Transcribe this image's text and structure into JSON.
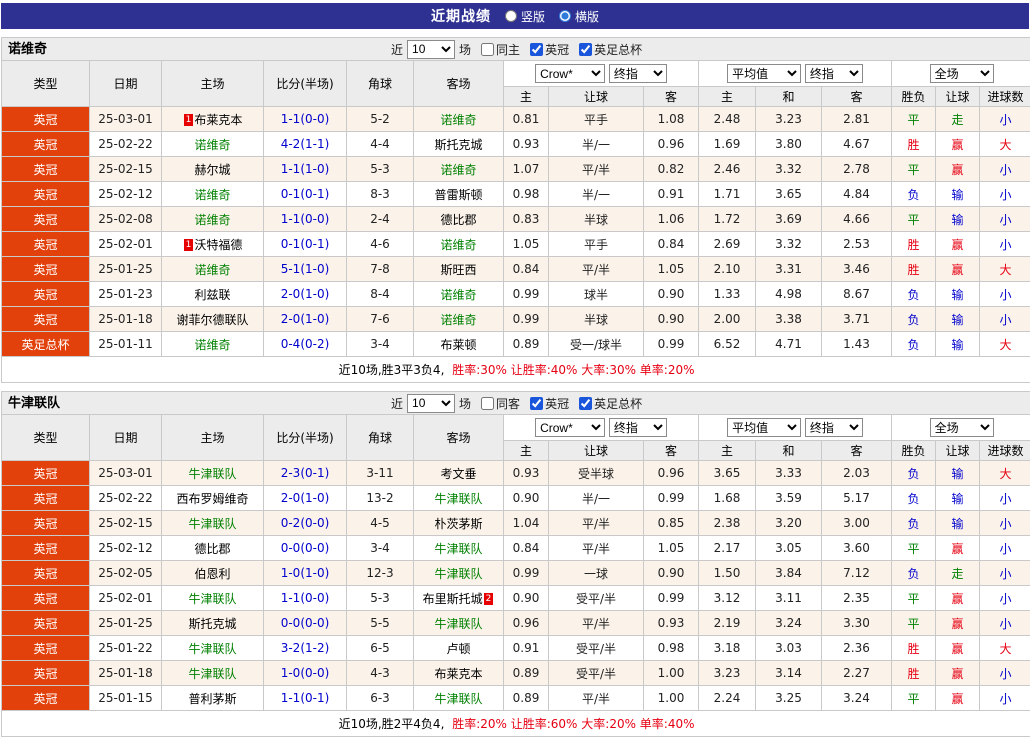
{
  "colors": {
    "topbar_bg": "#2e3192",
    "league_badge_bg": "#e2410c",
    "team_highlight_green": "#008000",
    "score_blue": "#0000cd",
    "result_win_red": "#e60012",
    "result_draw_green": "#008000",
    "result_loss_blue": "#0000cd"
  },
  "topbar": {
    "title": "近期战绩",
    "layout_options": [
      {
        "label": "竖版",
        "checked": false
      },
      {
        "label": "横版",
        "checked": true
      }
    ]
  },
  "header": {
    "main_columns": [
      "类型",
      "日期",
      "主场",
      "比分(半场)",
      "角球",
      "客场"
    ],
    "sub_columns": [
      "主",
      "让球",
      "客",
      "主",
      "和",
      "客",
      "胜负",
      "让球",
      "进球数"
    ],
    "group1_selects": [
      "Crow*",
      "终指"
    ],
    "group2_selects": [
      "平均值",
      "终指"
    ],
    "group3_selects": [
      "全场"
    ]
  },
  "tables": [
    {
      "team": "诺维奇",
      "filter": {
        "prefix": "近",
        "count": "10",
        "suffix": "场",
        "checkboxes": [
          {
            "label": "同主",
            "checked": false
          },
          {
            "label": "英冠",
            "checked": true
          },
          {
            "label": "英足总杯",
            "checked": true
          }
        ]
      },
      "rows": [
        {
          "type": "英冠",
          "date": "25-03-01",
          "home": "布莱克本",
          "home_badge": "1",
          "home_badge_pos": "pre",
          "score": "1-1(0-0)",
          "corner": "5-2",
          "away": "诺维奇",
          "away_green": true,
          "odds": [
            "0.81",
            "平手",
            "1.08"
          ],
          "avg": [
            "2.48",
            "3.23",
            "2.81"
          ],
          "result": [
            "平",
            "走",
            "小"
          ]
        },
        {
          "type": "英冠",
          "date": "25-02-22",
          "home": "诺维奇",
          "home_green": true,
          "score": "4-2(1-1)",
          "corner": "4-4",
          "away": "斯托克城",
          "odds": [
            "0.93",
            "半/一",
            "0.96"
          ],
          "avg": [
            "1.69",
            "3.80",
            "4.67"
          ],
          "result": [
            "胜",
            "赢",
            "大"
          ]
        },
        {
          "type": "英冠",
          "date": "25-02-15",
          "home": "赫尔城",
          "score": "1-1(1-0)",
          "corner": "5-3",
          "away": "诺维奇",
          "away_green": true,
          "odds": [
            "1.07",
            "平/半",
            "0.82"
          ],
          "avg": [
            "2.46",
            "3.32",
            "2.78"
          ],
          "result": [
            "平",
            "赢",
            "小"
          ]
        },
        {
          "type": "英冠",
          "date": "25-02-12",
          "home": "诺维奇",
          "home_green": true,
          "score": "0-1(0-1)",
          "corner": "8-3",
          "away": "普雷斯顿",
          "odds": [
            "0.98",
            "半/一",
            "0.91"
          ],
          "avg": [
            "1.71",
            "3.65",
            "4.84"
          ],
          "result": [
            "负",
            "输",
            "小"
          ]
        },
        {
          "type": "英冠",
          "date": "25-02-08",
          "home": "诺维奇",
          "home_green": true,
          "score": "1-1(0-0)",
          "corner": "2-4",
          "away": "德比郡",
          "odds": [
            "0.83",
            "半球",
            "1.06"
          ],
          "avg": [
            "1.72",
            "3.69",
            "4.66"
          ],
          "result": [
            "平",
            "输",
            "小"
          ]
        },
        {
          "type": "英冠",
          "date": "25-02-01",
          "home": "沃特福德",
          "home_badge": "1",
          "home_badge_pos": "pre",
          "score": "0-1(0-1)",
          "corner": "4-6",
          "away": "诺维奇",
          "away_green": true,
          "odds": [
            "1.05",
            "平手",
            "0.84"
          ],
          "avg": [
            "2.69",
            "3.32",
            "2.53"
          ],
          "result": [
            "胜",
            "赢",
            "小"
          ]
        },
        {
          "type": "英冠",
          "date": "25-01-25",
          "home": "诺维奇",
          "home_green": true,
          "score": "5-1(1-0)",
          "corner": "7-8",
          "away": "斯旺西",
          "odds": [
            "0.84",
            "平/半",
            "1.05"
          ],
          "avg": [
            "2.10",
            "3.31",
            "3.46"
          ],
          "result": [
            "胜",
            "赢",
            "大"
          ]
        },
        {
          "type": "英冠",
          "date": "25-01-23",
          "home": "利兹联",
          "score": "2-0(1-0)",
          "corner": "8-4",
          "away": "诺维奇",
          "away_green": true,
          "odds": [
            "0.99",
            "球半",
            "0.90"
          ],
          "avg": [
            "1.33",
            "4.98",
            "8.67"
          ],
          "result": [
            "负",
            "输",
            "小"
          ]
        },
        {
          "type": "英冠",
          "date": "25-01-18",
          "home": "谢菲尔德联队",
          "score": "2-0(1-0)",
          "corner": "7-6",
          "away": "诺维奇",
          "away_green": true,
          "odds": [
            "0.99",
            "半球",
            "0.90"
          ],
          "avg": [
            "2.00",
            "3.38",
            "3.71"
          ],
          "result": [
            "负",
            "输",
            "小"
          ]
        },
        {
          "type": "英足总杯",
          "date": "25-01-11",
          "home": "诺维奇",
          "home_green": true,
          "score": "0-4(0-2)",
          "corner": "3-4",
          "away": "布莱顿",
          "odds": [
            "0.89",
            "受一/球半",
            "0.99"
          ],
          "avg": [
            "6.52",
            "4.71",
            "1.43"
          ],
          "result": [
            "负",
            "输",
            "大"
          ]
        }
      ],
      "footer_plain": "近10场,胜3平3负4,",
      "footer_red": "胜率:30% 让胜率:40% 大率:30% 单率:20%"
    },
    {
      "team": "牛津联队",
      "filter": {
        "prefix": "近",
        "count": "10",
        "suffix": "场",
        "checkboxes": [
          {
            "label": "同客",
            "checked": false
          },
          {
            "label": "英冠",
            "checked": true
          },
          {
            "label": "英足总杯",
            "checked": true
          }
        ]
      },
      "rows": [
        {
          "type": "英冠",
          "date": "25-03-01",
          "home": "牛津联队",
          "home_green": true,
          "score": "2-3(0-1)",
          "corner": "3-11",
          "away": "考文垂",
          "odds": [
            "0.93",
            "受半球",
            "0.96"
          ],
          "avg": [
            "3.65",
            "3.33",
            "2.03"
          ],
          "result": [
            "负",
            "输",
            "大"
          ]
        },
        {
          "type": "英冠",
          "date": "25-02-22",
          "home": "西布罗姆维奇",
          "score": "2-0(1-0)",
          "corner": "13-2",
          "away": "牛津联队",
          "away_green": true,
          "odds": [
            "0.90",
            "半/一",
            "0.99"
          ],
          "avg": [
            "1.68",
            "3.59",
            "5.17"
          ],
          "result": [
            "负",
            "输",
            "小"
          ]
        },
        {
          "type": "英冠",
          "date": "25-02-15",
          "home": "牛津联队",
          "home_green": true,
          "score": "0-2(0-0)",
          "corner": "4-5",
          "away": "朴茨茅斯",
          "odds": [
            "1.04",
            "平/半",
            "0.85"
          ],
          "avg": [
            "2.38",
            "3.20",
            "3.00"
          ],
          "result": [
            "负",
            "输",
            "小"
          ]
        },
        {
          "type": "英冠",
          "date": "25-02-12",
          "home": "德比郡",
          "score": "0-0(0-0)",
          "corner": "3-4",
          "away": "牛津联队",
          "away_green": true,
          "odds": [
            "0.84",
            "平/半",
            "1.05"
          ],
          "avg": [
            "2.17",
            "3.05",
            "3.60"
          ],
          "result": [
            "平",
            "赢",
            "小"
          ]
        },
        {
          "type": "英冠",
          "date": "25-02-05",
          "home": "伯恩利",
          "score": "1-0(1-0)",
          "corner": "12-3",
          "away": "牛津联队",
          "away_green": true,
          "odds": [
            "0.99",
            "一球",
            "0.90"
          ],
          "avg": [
            "1.50",
            "3.84",
            "7.12"
          ],
          "result": [
            "负",
            "走",
            "小"
          ]
        },
        {
          "type": "英冠",
          "date": "25-02-01",
          "home": "牛津联队",
          "home_green": true,
          "score": "1-1(0-0)",
          "corner": "5-3",
          "away": "布里斯托城",
          "away_badge": "2",
          "away_badge_pos": "post",
          "odds": [
            "0.90",
            "受平/半",
            "0.99"
          ],
          "avg": [
            "3.12",
            "3.11",
            "2.35"
          ],
          "result": [
            "平",
            "赢",
            "小"
          ]
        },
        {
          "type": "英冠",
          "date": "25-01-25",
          "home": "斯托克城",
          "score": "0-0(0-0)",
          "corner": "5-5",
          "away": "牛津联队",
          "away_green": true,
          "odds": [
            "0.96",
            "平/半",
            "0.93"
          ],
          "avg": [
            "2.19",
            "3.24",
            "3.30"
          ],
          "result": [
            "平",
            "赢",
            "小"
          ]
        },
        {
          "type": "英冠",
          "date": "25-01-22",
          "home": "牛津联队",
          "home_green": true,
          "score": "3-2(1-2)",
          "corner": "6-5",
          "away": "卢顿",
          "odds": [
            "0.91",
            "受平/半",
            "0.98"
          ],
          "avg": [
            "3.18",
            "3.03",
            "2.36"
          ],
          "result": [
            "胜",
            "赢",
            "大"
          ]
        },
        {
          "type": "英冠",
          "date": "25-01-18",
          "home": "牛津联队",
          "home_green": true,
          "score": "1-0(0-0)",
          "corner": "4-3",
          "away": "布莱克本",
          "odds": [
            "0.89",
            "受平/半",
            "1.00"
          ],
          "avg": [
            "3.23",
            "3.14",
            "2.27"
          ],
          "result": [
            "胜",
            "赢",
            "小"
          ]
        },
        {
          "type": "英冠",
          "date": "25-01-15",
          "home": "普利茅斯",
          "score": "1-1(0-1)",
          "corner": "6-3",
          "away": "牛津联队",
          "away_green": true,
          "odds": [
            "0.89",
            "平/半",
            "1.00"
          ],
          "avg": [
            "2.24",
            "3.25",
            "3.24"
          ],
          "result": [
            "平",
            "赢",
            "小"
          ]
        }
      ],
      "footer_plain": "近10场,胜2平4负4,",
      "footer_red": "胜率:20% 让胜率:60% 大率:20% 单率:40%"
    }
  ]
}
